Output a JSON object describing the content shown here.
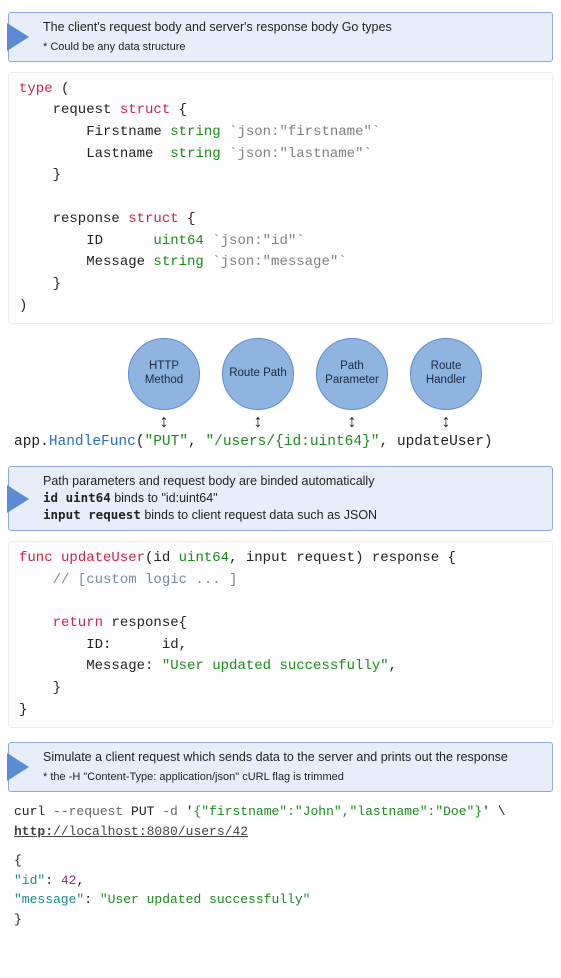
{
  "callout1": {
    "title": "The client's request body and server's response body Go types",
    "footnote": "* Could be any data structure"
  },
  "code1": {
    "kw_type": "type",
    "open_paren": " (",
    "req_name": "    request ",
    "kw_struct1": "struct",
    "open_brace1": " {",
    "fn_first": "        Firstname ",
    "typ_string1": "string",
    "tag_first": " `json:\"firstname\"`",
    "fn_last": "        Lastname  ",
    "typ_string2": "string",
    "tag_last": " `json:\"lastname\"`",
    "close_brace1": "    }",
    "res_name": "    response ",
    "kw_struct2": "struct",
    "open_brace2": " {",
    "fn_id": "        ID      ",
    "typ_uint64": "uint64",
    "tag_id": " `json:\"id\"`",
    "fn_msg": "        Message ",
    "typ_string3": "string",
    "tag_msg": " `json:\"message\"`",
    "close_brace2": "    }",
    "close_paren": ")"
  },
  "bubbles": [
    "HTTP Method",
    "Route Path",
    "Path Parameter",
    "Route Handler"
  ],
  "handlefunc": {
    "prefix": "app.",
    "fn": "HandleFunc",
    "open": "(",
    "method": "\"PUT\"",
    "comma1": ", ",
    "path": "\"/users/{id:uint64}\"",
    "comma2": ", ",
    "handler": "updateUser)",
    "tail": ""
  },
  "callout2": {
    "line1": "Path parameters and request body are binded automatically",
    "bold1": "id uint64",
    "rest1": " binds to \"id:uint64\"",
    "bold2": "input request",
    "rest2": " binds to client request data such as JSON"
  },
  "code2": {
    "kw_func": "func",
    "sp1": " ",
    "fname": "updateUser",
    "sig_open": "(id ",
    "typ_uint64": "uint64",
    "sig_mid": ", input request) response {",
    "comment": "    // [custom logic ... ]",
    "kw_return": "    return",
    "ret_open": " response{",
    "id_line_pre": "        ID:      id,",
    "msg_line_pre": "        Message: ",
    "msg_str": "\"User updated successfully\"",
    "msg_line_post": ",",
    "close1": "    }",
    "close2": "}"
  },
  "callout3": {
    "title": "Simulate a client request which sends data to the server and prints out the response",
    "footnote": "* the -H \"Content-Type: application/json\" cURL flag is trimmed"
  },
  "curl": {
    "cmd": "curl ",
    "flag1": "--request",
    "method": " PUT ",
    "flag2": "-d",
    "sp": " ",
    "q1": "'",
    "body": "{\"firstname\":\"John\",\"lastname\":\"Doe\"}",
    "q2": "'",
    "cont": " \\",
    "scheme": "http:",
    "url_rest": "//localhost:8080/users/42",
    "resp_open": "{",
    "resp_id_key": "  \"id\"",
    "resp_id_colon": ": ",
    "resp_id_val": "42",
    "resp_comma": ",",
    "resp_msg_key": "  \"message\"",
    "resp_msg_colon": ": ",
    "resp_msg_val": "\"User updated successfully\"",
    "resp_close": "}"
  }
}
